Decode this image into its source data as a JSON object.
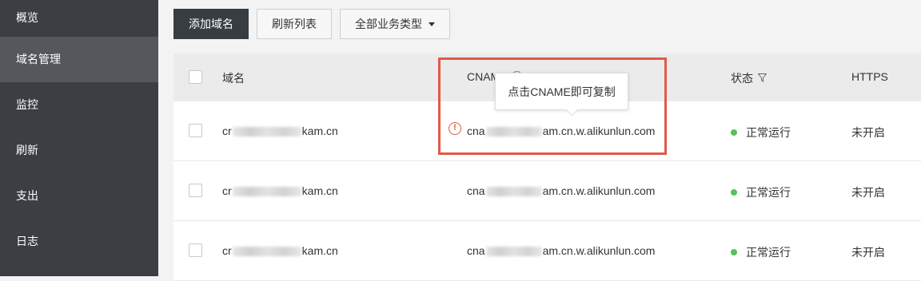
{
  "sidebar": {
    "items": [
      {
        "label": "概览"
      },
      {
        "label": "域名管理"
      },
      {
        "label": "监控"
      },
      {
        "label": "刷新"
      },
      {
        "label": "支出"
      },
      {
        "label": "日志"
      }
    ]
  },
  "toolbar": {
    "add_domain": "添加域名",
    "refresh_list": "刷新列表",
    "business_type": "全部业务类型"
  },
  "table": {
    "headers": {
      "domain": "域名",
      "cname": "CNAME",
      "status": "状态",
      "https": "HTTPS"
    },
    "rows": [
      {
        "domain_prefix": "cr",
        "domain_suffix": "kam.cn",
        "cname_prefix": "cna",
        "cname_suffix": "am.cn.w.alikunlun.com",
        "status": "正常运行",
        "https": "未开启"
      },
      {
        "domain_prefix": "cr",
        "domain_suffix": "kam.cn",
        "cname_prefix": "cna",
        "cname_suffix": "am.cn.w.alikunlun.com",
        "status": "正常运行",
        "https": "未开启"
      },
      {
        "domain_prefix": "cr",
        "domain_suffix": "kam.cn",
        "cname_prefix": "cna",
        "cname_suffix": "am.cn.w.alikunlun.com",
        "status": "正常运行",
        "https": "未开启"
      }
    ]
  },
  "tooltip": {
    "text": "点击CNAME即可复制"
  },
  "colors": {
    "sidebar_bg": "#3b3e43",
    "sidebar_active": "#54575c",
    "primary_button": "#373d41",
    "status_ok": "#54c35a",
    "highlight": "#e05a48"
  }
}
